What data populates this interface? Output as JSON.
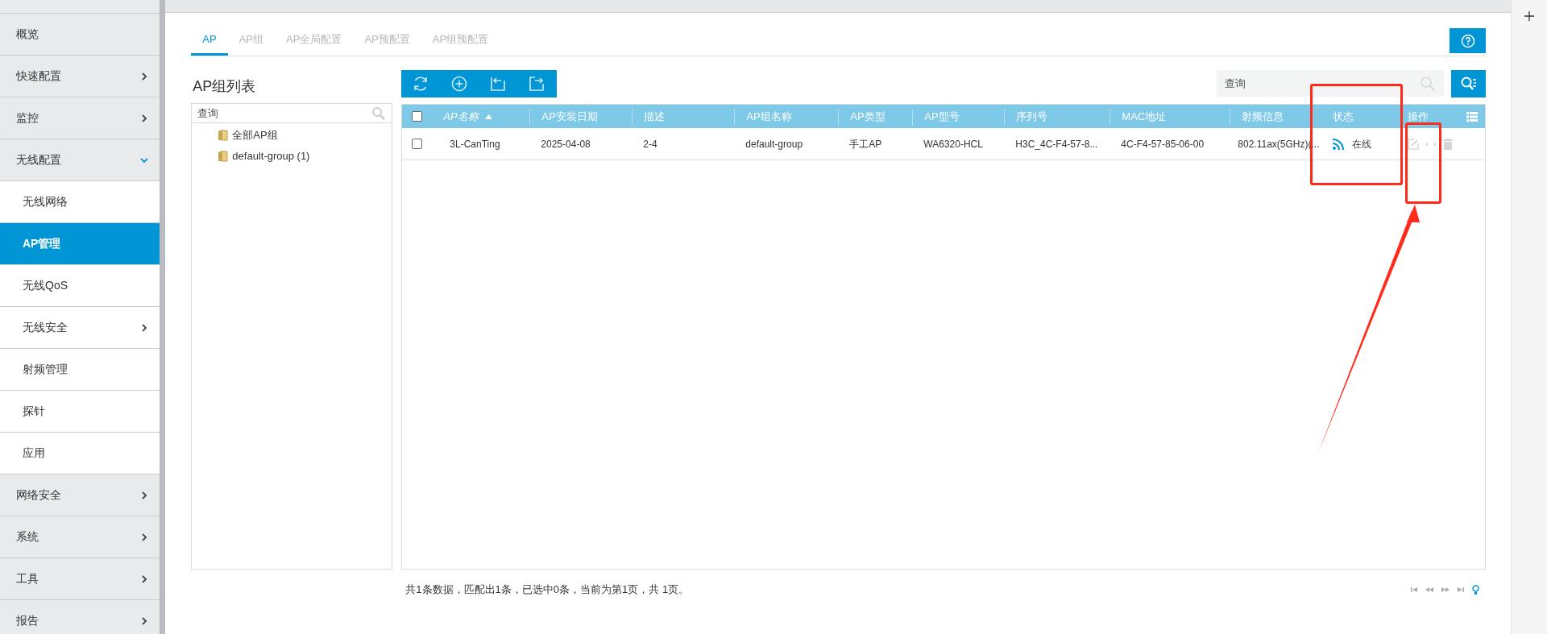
{
  "sidebar": {
    "items": [
      {
        "label": "概览",
        "submenu": false,
        "selected": false
      },
      {
        "label": "快速配置",
        "submenu": true,
        "expanded": false,
        "selected": false
      },
      {
        "label": "监控",
        "submenu": true,
        "expanded": false,
        "selected": false
      },
      {
        "label": "无线配置",
        "submenu": true,
        "expanded": true,
        "selected": false,
        "children": [
          {
            "label": "无线网络",
            "submenu": false,
            "selected": false
          },
          {
            "label": "AP管理",
            "submenu": false,
            "selected": true
          },
          {
            "label": "无线QoS",
            "submenu": false,
            "selected": false
          },
          {
            "label": "无线安全",
            "submenu": true,
            "selected": false
          },
          {
            "label": "射频管理",
            "submenu": false,
            "selected": false
          },
          {
            "label": "探针",
            "submenu": false,
            "selected": false
          },
          {
            "label": "应用",
            "submenu": false,
            "selected": false
          }
        ]
      },
      {
        "label": "网络安全",
        "submenu": true,
        "expanded": false,
        "selected": false
      },
      {
        "label": "系统",
        "submenu": true,
        "expanded": false,
        "selected": false
      },
      {
        "label": "工具",
        "submenu": true,
        "expanded": false,
        "selected": false
      },
      {
        "label": "报告",
        "submenu": true,
        "expanded": false,
        "selected": false
      }
    ]
  },
  "tabs": [
    {
      "label": "AP",
      "selected": true
    },
    {
      "label": "AP组",
      "selected": false
    },
    {
      "label": "AP全局配置",
      "selected": false
    },
    {
      "label": "AP预配置",
      "selected": false
    },
    {
      "label": "AP组预配置",
      "selected": false
    }
  ],
  "group_panel": {
    "title": "AP组列表",
    "search": {
      "placeholder": "查询"
    },
    "tree": [
      {
        "label": "全部AP组"
      },
      {
        "label": "default-group (1)"
      }
    ]
  },
  "search": {
    "placeholder": "查询"
  },
  "table": {
    "all_checked": false,
    "columns": [
      {
        "label": "AP名称",
        "sorted": true
      },
      {
        "label": "AP安装日期",
        "sorted": false
      },
      {
        "label": "描述",
        "sorted": false
      },
      {
        "label": "AP组名称",
        "sorted": false
      },
      {
        "label": "AP类型",
        "sorted": false
      },
      {
        "label": "AP型号",
        "sorted": false
      },
      {
        "label": "序列号",
        "sorted": false
      },
      {
        "label": "MAC地址",
        "sorted": false
      },
      {
        "label": "射频信息",
        "sorted": false
      },
      {
        "label": "状态",
        "sorted": false
      },
      {
        "label": "操作",
        "sorted": false
      }
    ],
    "rows": [
      {
        "checked": false,
        "online": true,
        "cells": [
          "3L-CanTing",
          "2025-04-08",
          "2-4",
          "default-group",
          "手工AP",
          "WA6320-HCL",
          "H3C_4C-F4-57-8...",
          "4C-F4-57-85-06-00",
          "802.11ax(5GHz)(...",
          "在线"
        ]
      }
    ]
  },
  "footer": "共1条数据，匹配出1条，已选中0条，当前为第1页，共 1页。"
}
